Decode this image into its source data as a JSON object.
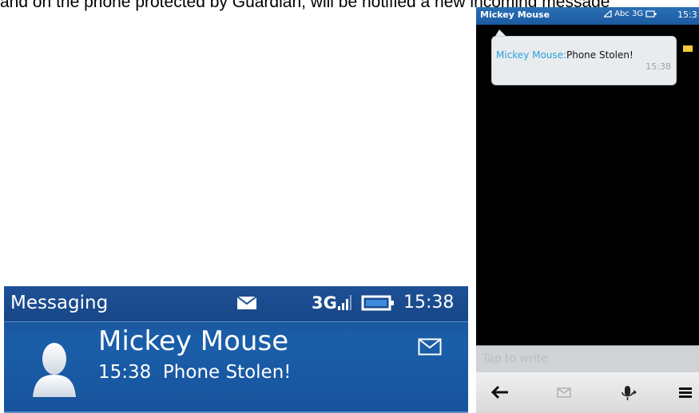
{
  "caption": "and on the phone protected by Guardian, will be notified a new incoming message",
  "messaging": {
    "title": "Messaging",
    "network": "3G",
    "time": "15:38",
    "conversation": {
      "name": "Mickey Mouse",
      "time": "15:38",
      "preview": "Phone Stolen!"
    }
  },
  "phone": {
    "title": "Mickey Mouse",
    "status_icons": "Abc 3G",
    "time": "15:3",
    "message": {
      "sender": "Mickey Mouse:",
      "text": "Phone Stolen!",
      "time": "15:38"
    },
    "input_placeholder": "Tap to write",
    "icons": [
      "back-arrow-icon",
      "envelope-icon",
      "microphone-icon",
      "menu-icon"
    ]
  },
  "colors": {
    "messaging_bg": "#1a5ea9",
    "sender_blue": "#2aa2d8"
  }
}
